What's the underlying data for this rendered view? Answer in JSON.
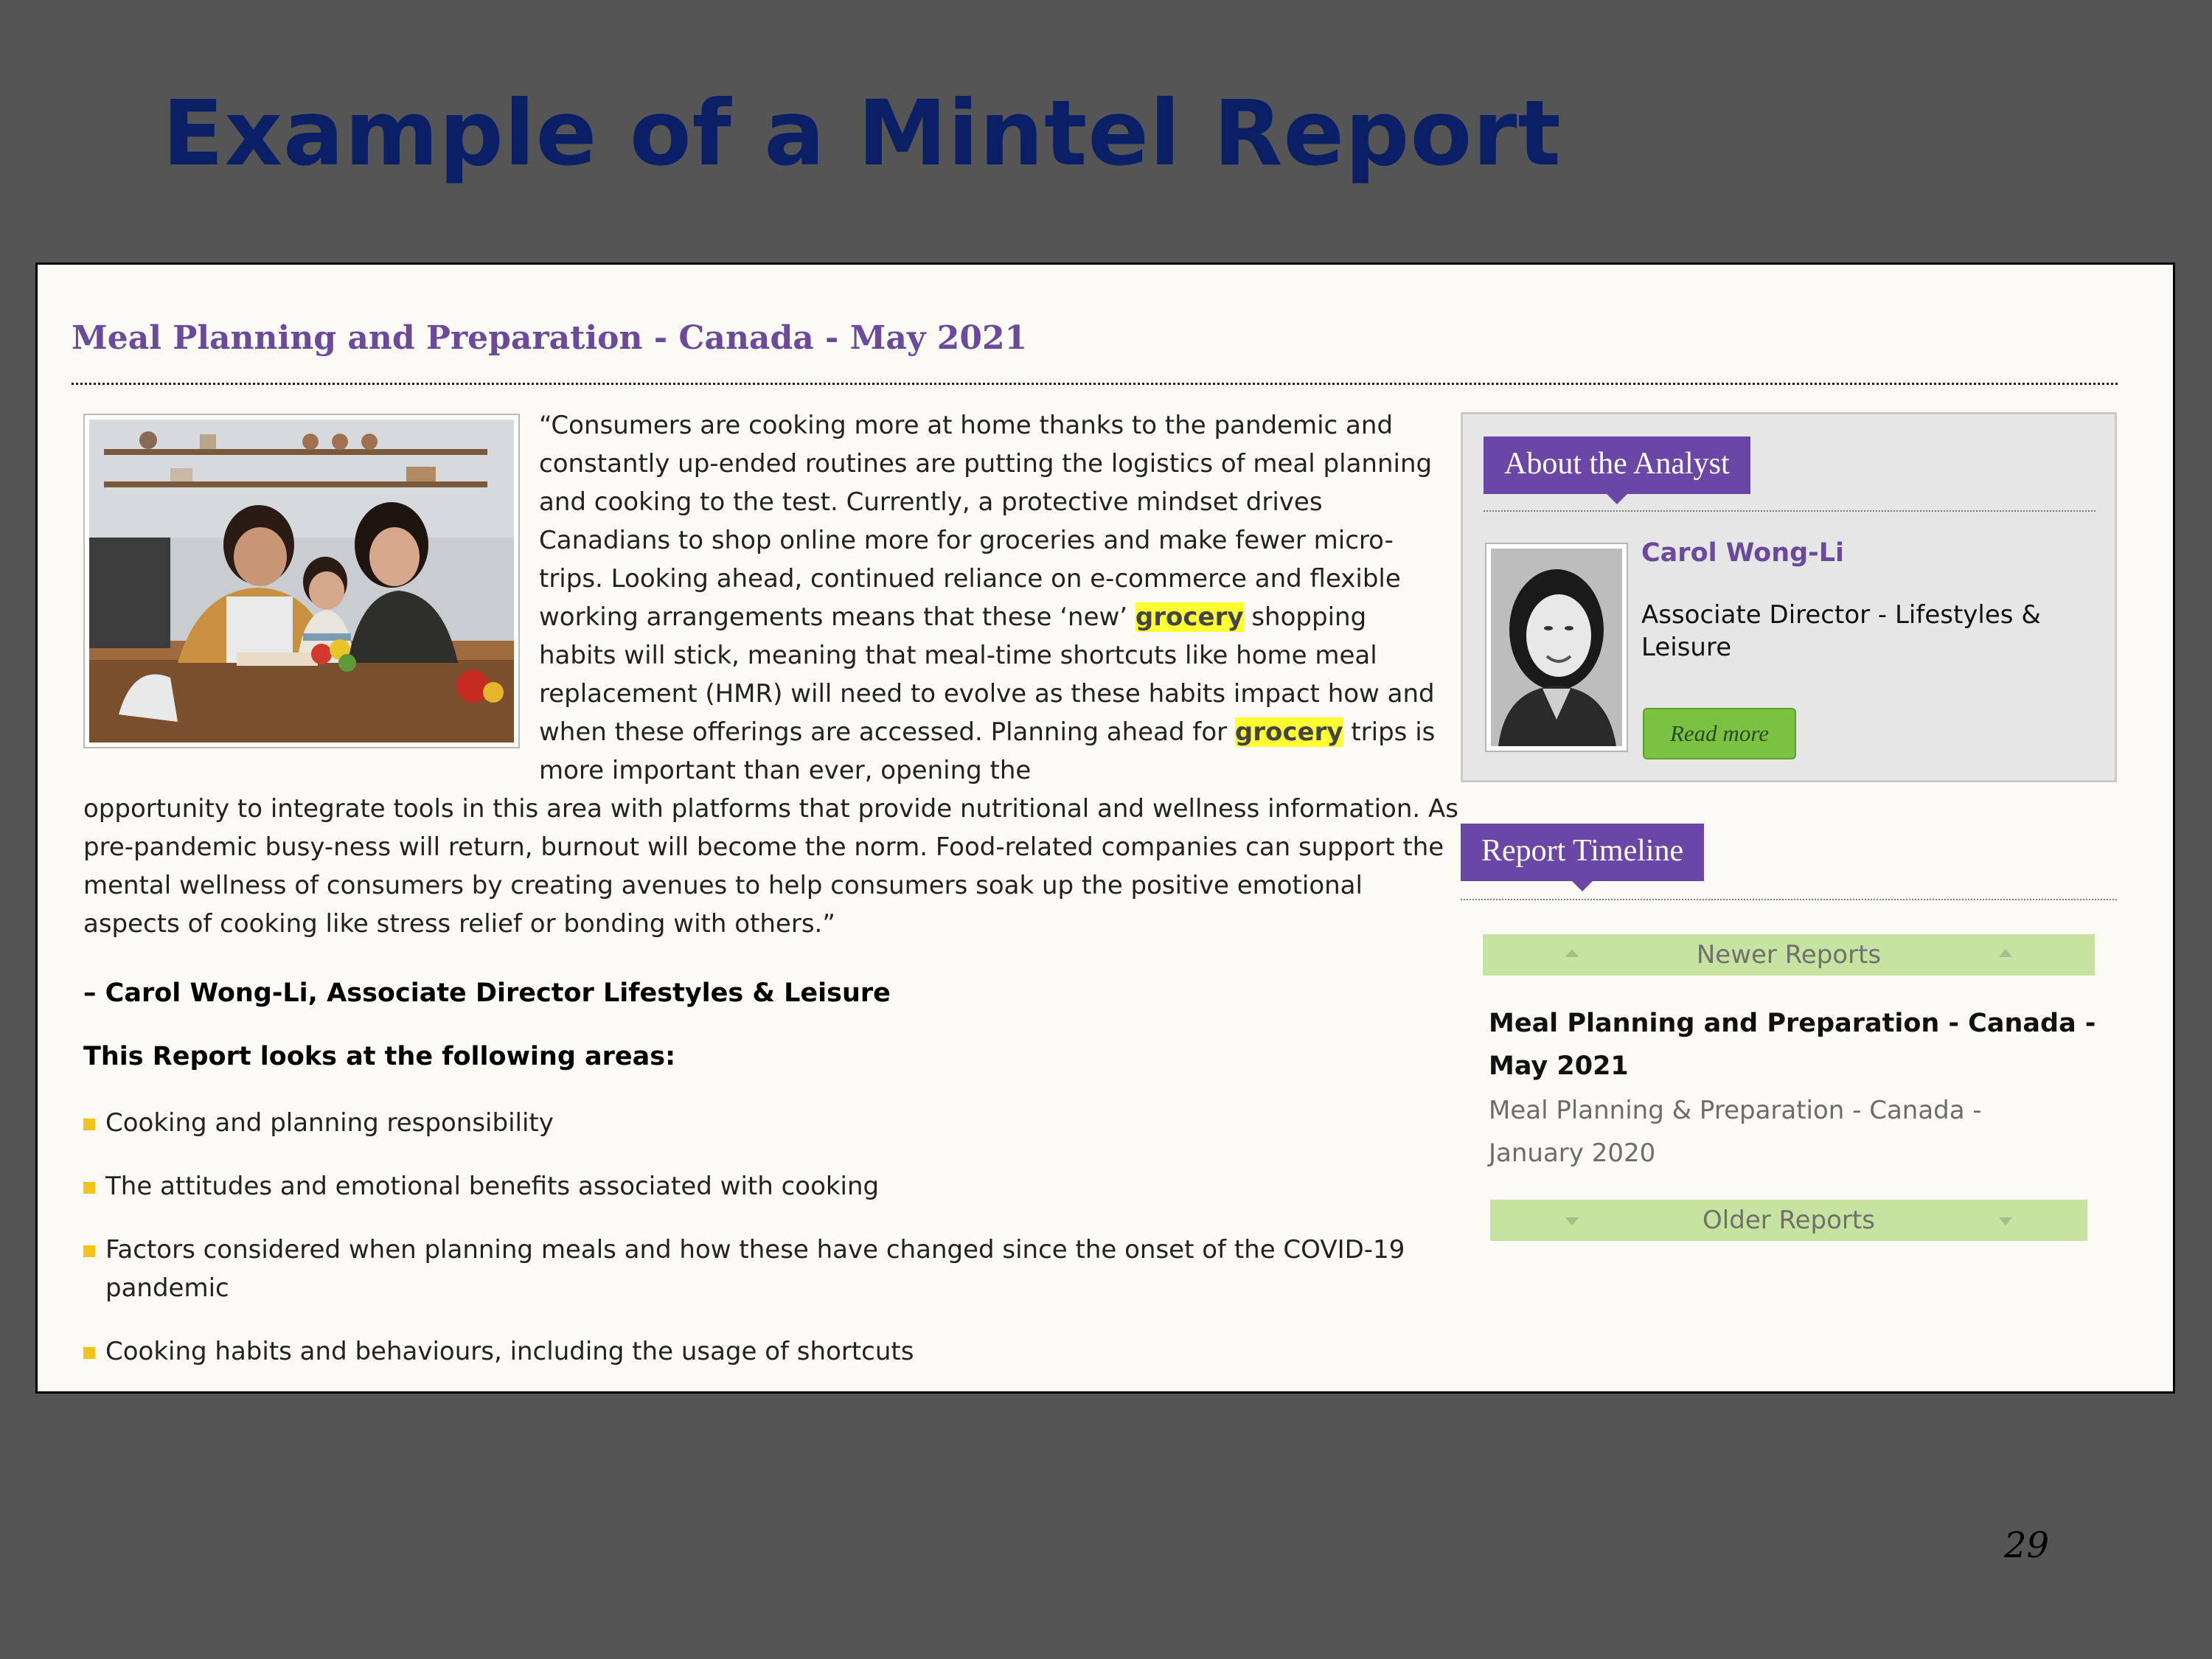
{
  "slide": {
    "title": "Example of a Mintel Report",
    "page_number": "29"
  },
  "report": {
    "title": "Meal Planning and Preparation - Canada - May 2021",
    "quote_segments": [
      "“Consumers are cooking more at home thanks to the pandemic and constantly up-ended routines are putting the logistics of meal planning and cooking to the test. Currently, a protective mindset drives Canadians to shop online more for groceries and make fewer micro-trips. Looking ahead, continued reliance on e-commerce and flexible working arrangements means that these ‘new’ ",
      "grocery",
      " shopping habits will stick, meaning that meal-time shortcuts like home meal replacement (HMR) will need to evolve as these habits impact how and when these offerings are accessed. Planning ahead for ",
      "grocery",
      " trips is more important than ever, opening the",
      "opportunity to integrate tools in this area with platforms that provide nutritional and wellness information. As pre-pandemic busy-ness will return, burnout will become the norm. Food-related companies can support the mental wellness of consumers by creating avenues to help consumers soak up the positive emotional aspects of cooking like stress relief or bonding with others.”"
    ],
    "attribution": "– Carol Wong-Li, Associate Director Lifestyles & Leisure",
    "areas_heading": "This Report looks at the following areas:",
    "areas": [
      "Cooking and planning responsibility",
      "The attitudes and emotional benefits associated with cooking",
      "Factors considered when planning meals and how these have changed since the onset of the COVID-19 pandemic",
      "Cooking habits and behaviours, including the usage of shortcuts"
    ]
  },
  "analyst": {
    "heading": "About the Analyst",
    "name": "Carol Wong-Li",
    "role": "Associate Director - Lifestyles & Leisure",
    "read_more": "Read more"
  },
  "timeline": {
    "heading": "Report Timeline",
    "newer_label": "Newer Reports",
    "older_label": "Older Reports",
    "current_report": "Meal Planning and Preparation - Canada - May 2021",
    "older_report": "Meal Planning & Preparation - Canada - January 2020"
  },
  "colors": {
    "slide_background": "#555555",
    "slide_title": "#0b1f66",
    "accent_purple": "#6a46a6",
    "highlight": "#ffff33",
    "button_green": "#7cc242",
    "timeline_green": "#c6e39f",
    "bullet_yellow": "#f0c419"
  },
  "icons": {
    "bullet": "yellow-square-bullet",
    "timeline_arrow_up": "triangle-up-icon",
    "timeline_arrow_down": "triangle-down-icon"
  }
}
